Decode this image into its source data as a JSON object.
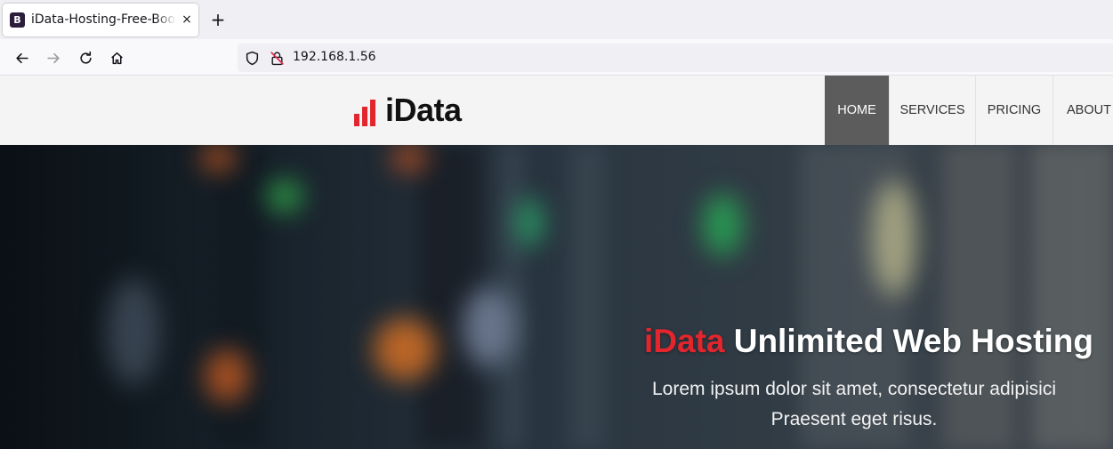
{
  "browser": {
    "tab": {
      "favicon_letter": "B",
      "title": "iData-Hosting-Free-Bootstrap",
      "close_glyph": "×"
    },
    "new_tab_glyph": "+",
    "url": "192.168.1.56"
  },
  "site": {
    "logo_text": "iData",
    "brand_color": "#e3262d",
    "menu": [
      {
        "label": "HOME",
        "active": true
      },
      {
        "label": "SERVICES",
        "active": false
      },
      {
        "label": "PRICING",
        "active": false
      },
      {
        "label": "ABOUT",
        "active": false
      }
    ],
    "hero": {
      "title_accent": "iData",
      "title_rest": " Unlimited Web Hosting",
      "subtitle_line1": "Lorem ipsum dolor sit amet, consectetur adipisici",
      "subtitle_line2": "Praesent eget risus."
    }
  }
}
